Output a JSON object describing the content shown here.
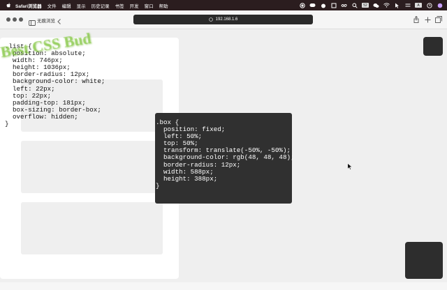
{
  "menubar": {
    "app_name": "Safari浏览器",
    "items": [
      "文件",
      "编辑",
      "显示",
      "历史记录",
      "书签",
      "开发",
      "窗口",
      "帮助"
    ],
    "status_badge": "A"
  },
  "toolbar": {
    "tab_title": "无痕浏览",
    "address": "192.168.1.6"
  },
  "watermark": "Best CSS Bud",
  "list_code": ".list {\n  position: absolute;\n  width: 746px;\n  height: 1036px;\n  border-radius: 12px;\n  background-color: white;\n  left: 22px;\n  top: 22px;\n  padding-top: 181px;\n  box-sizing: border-box;\n  overflow: hidden;\n}",
  "box_code": ".box {\n  position: fixed;\n  left: 50%;\n  top: 50%;\n  transform: translate(-50%, -50%);\n  background-color: rgb(48, 48, 48);\n  border-radius: 12px;\n  width: 588px;\n  height: 388px;\n}",
  "colors": {
    "page_bg": "#efefef",
    "box_bg": "#303030",
    "menubar_bg": "#2b1d1f",
    "watermark": "#82c83c"
  }
}
